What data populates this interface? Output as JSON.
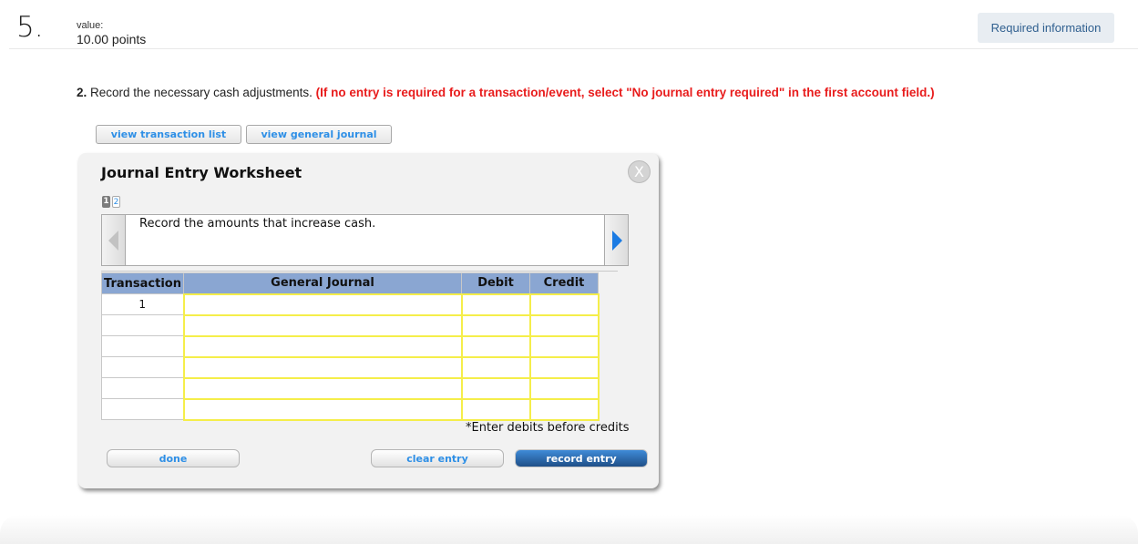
{
  "header": {
    "question_number": "5.",
    "value_label": "value:",
    "value_points": "10.00 points",
    "required_info_button": "Required information"
  },
  "instruction": {
    "number": "2.",
    "text": " Record the necessary cash adjustments. ",
    "note": "(If no entry is required for a transaction/event, select \"No journal entry required\" in the first account field.)"
  },
  "top_buttons": {
    "view_transaction_list": "view transaction list",
    "view_general_journal": "view general journal"
  },
  "worksheet": {
    "title": "Journal Entry Worksheet",
    "close_label": "X",
    "pages": [
      "1",
      "2"
    ],
    "active_page": "1",
    "prompt": "Record the amounts that increase cash.",
    "columns": [
      "Transaction",
      "General Journal",
      "Debit",
      "Credit"
    ],
    "rows": [
      {
        "transaction": "1",
        "account": "",
        "debit": "",
        "credit": ""
      },
      {
        "transaction": "",
        "account": "",
        "debit": "",
        "credit": ""
      },
      {
        "transaction": "",
        "account": "",
        "debit": "",
        "credit": ""
      },
      {
        "transaction": "",
        "account": "",
        "debit": "",
        "credit": ""
      },
      {
        "transaction": "",
        "account": "",
        "debit": "",
        "credit": ""
      },
      {
        "transaction": "",
        "account": "",
        "debit": "",
        "credit": ""
      }
    ],
    "note": "*Enter debits before credits",
    "buttons": {
      "done": "done",
      "clear_entry": "clear entry",
      "record_entry": "record entry"
    }
  },
  "colors": {
    "accent_blue": "#2e8fe6",
    "warning_red": "#e81c1c",
    "table_header": "#8aa6d2",
    "input_border": "#f5ee4a",
    "record_button": "#1f4f88"
  }
}
